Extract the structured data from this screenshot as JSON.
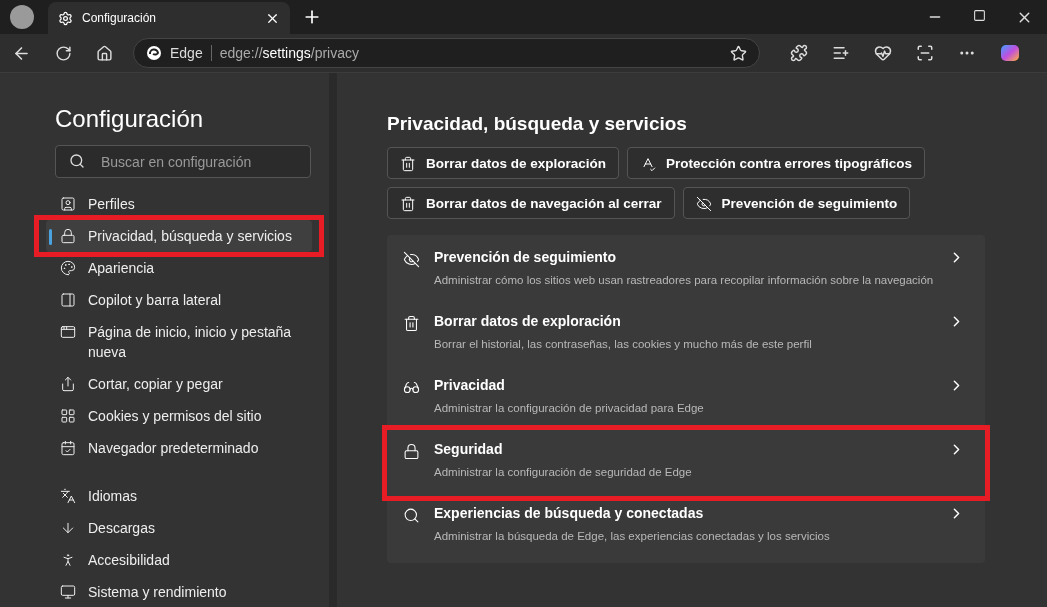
{
  "tab": {
    "title": "Configuración",
    "selected": true
  },
  "address_bar": {
    "site": "Edge",
    "url": "edge://**settings**/privacy"
  },
  "sidebar": {
    "title": "Configuración",
    "search": {
      "placeholder": "Buscar en configuración"
    },
    "groups": [
      [
        {
          "label": "Perfiles",
          "selected": false,
          "highlighted": false
        },
        {
          "label": "Privacidad, búsqueda y servicios",
          "selected": true,
          "highlighted": true
        },
        {
          "label": "Apariencia",
          "selected": false,
          "highlighted": false
        },
        {
          "label": "Copilot y barra lateral",
          "selected": false,
          "highlighted": false
        },
        {
          "label": "Página de inicio, inicio y pestaña nueva",
          "selected": false,
          "highlighted": false
        },
        {
          "label": "Cortar, copiar y pegar",
          "selected": false,
          "highlighted": false
        },
        {
          "label": "Cookies y permisos del sitio",
          "selected": false,
          "highlighted": false
        },
        {
          "label": "Navegador predeterminado",
          "selected": false,
          "highlighted": false
        }
      ],
      [
        {
          "label": "Idiomas",
          "selected": false,
          "highlighted": false
        },
        {
          "label": "Descargas",
          "selected": false,
          "highlighted": false
        },
        {
          "label": "Accesibilidad",
          "selected": false,
          "highlighted": false
        },
        {
          "label": "Sistema y rendimiento",
          "selected": false,
          "highlighted": false
        }
      ]
    ]
  },
  "main": {
    "title": "Privacidad, búsqueda y servicios",
    "quick_buttons": [
      [
        "Borrar datos de exploración",
        "Protección contra errores tipográficos"
      ],
      [
        "Borrar datos de navegación al cerrar",
        "Prevención de seguimiento"
      ]
    ],
    "rows": [
      {
        "title": "Prevención de seguimiento",
        "description": "Administrar cómo los sitios web usan rastreadores para recopilar información sobre la navegación",
        "highlighted": false
      },
      {
        "title": "Borrar datos de exploración",
        "description": "Borrar el historial, las contraseñas, las cookies y mucho más de este perfil",
        "highlighted": false
      },
      {
        "title": "Privacidad",
        "description": "Administrar la configuración de privacidad para Edge",
        "highlighted": false
      },
      {
        "title": "Seguridad",
        "description": "Administrar la configuración de seguridad de Edge",
        "highlighted": true
      },
      {
        "title": "Experiencias de búsqueda y conectadas",
        "description": "Administrar la búsqueda de Edge, las experiencias conectadas y los servicios",
        "highlighted": false
      }
    ]
  }
}
